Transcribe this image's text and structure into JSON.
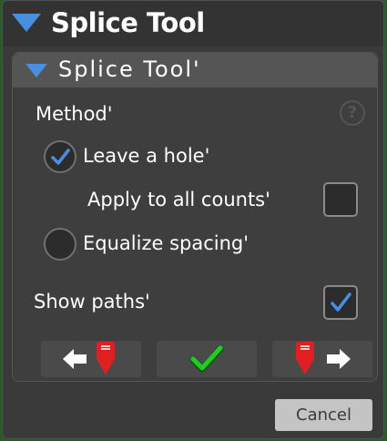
{
  "window": {
    "title": "Splice Tool"
  },
  "panel": {
    "title": "Splice Tool'"
  },
  "method": {
    "label": "Method'",
    "help_glyph": "?",
    "options": [
      {
        "label": "Leave a hole'",
        "selected": true
      },
      {
        "label": "Equalize spacing'",
        "selected": false
      }
    ],
    "apply_all": {
      "label": "Apply to all counts'",
      "checked": false
    }
  },
  "show_paths": {
    "label": "Show paths'",
    "checked": true
  },
  "actions": {
    "prev_icon": "arrow-left-marker-icon",
    "confirm_icon": "green-checkmark-icon",
    "next_icon": "marker-arrow-right-icon"
  },
  "footer": {
    "cancel_label": "Cancel"
  },
  "colors": {
    "accent_blue": "#4a8ee0",
    "marker_red": "#e02020",
    "confirm_green": "#22cc22"
  }
}
